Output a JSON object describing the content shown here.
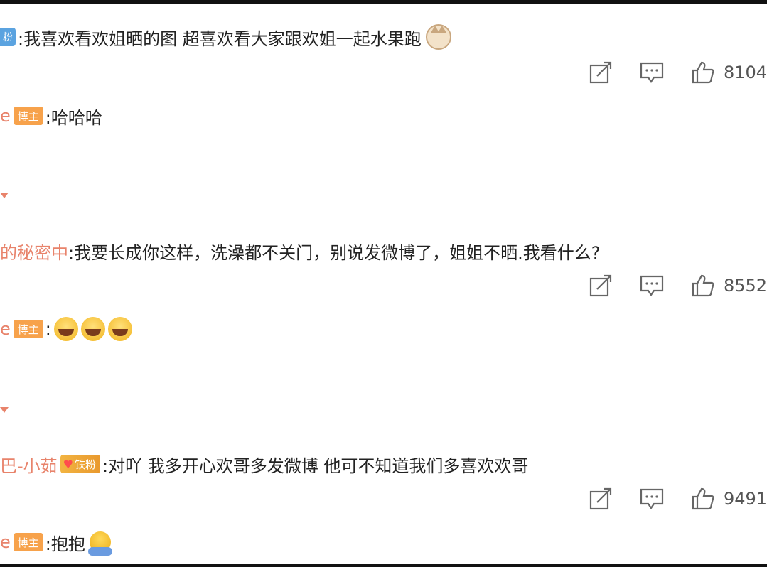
{
  "comments": [
    {
      "user": "",
      "badge": "粉",
      "text": ":我喜欢看欢姐晒的图 超喜欢看大家跟欢姐一起水果跑",
      "emoji": "cat-face-emoji",
      "likes": "8104",
      "reply": {
        "user": "e",
        "badge": "博主",
        "text": ":哈哈哈",
        "emojis": []
      }
    },
    {
      "user": "的秘密中",
      "badge": "",
      "text": ":我要长成你这样，洗澡都不关门，别说发微博了，姐姐不晒.我看什么?",
      "emoji": "",
      "likes": "8552",
      "reply": {
        "user": "e",
        "badge": "博主",
        "text": ":",
        "emojis": [
          "laughing-tears-emoji",
          "laughing-tears-emoji",
          "laughing-tears-emoji"
        ]
      }
    },
    {
      "user": "巴-小茹",
      "badge": "铁粉",
      "text": ":对吖 我多开心欢哥多发微博 他可不知道我们多喜欢欢哥",
      "emoji": "",
      "likes": "9491",
      "reply": {
        "user": "e",
        "badge": "博主",
        "text": ":抱抱",
        "emojis": [
          "hug-emoji"
        ]
      }
    }
  ],
  "colors": {
    "username": "#e8836b",
    "host_badge": "#f7a24b",
    "fan_badge": "#5ba3e0",
    "icon": "#666666"
  },
  "icons": {
    "share": "share-icon",
    "comment": "comment-icon",
    "like": "thumbs-up-icon",
    "fold": "expand-arrow-icon"
  }
}
